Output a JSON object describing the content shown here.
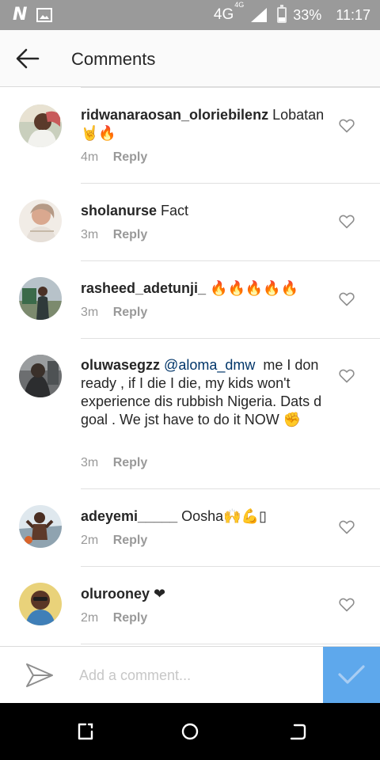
{
  "status_bar": {
    "network": "4G",
    "network_small": "4G",
    "battery_percent": "33%",
    "battery_level": 0.33,
    "time": "11:17",
    "icons": [
      "n-logo-icon",
      "image-icon",
      "signal-icon",
      "battery-icon"
    ]
  },
  "header": {
    "title": "Comments",
    "back_icon": "back-arrow-icon"
  },
  "comments": [
    {
      "username": "ridwanaraosan_oloriebilenz",
      "text": "Lobatan",
      "emoji": "🤘🔥",
      "time": "4m",
      "reply_label": "Reply"
    },
    {
      "username": "sholanurse",
      "text": "Fact",
      "emoji": "",
      "time": "3m",
      "reply_label": "Reply"
    },
    {
      "username": "rasheed_adetunji_",
      "text": "",
      "emoji": "🔥🔥🔥🔥🔥",
      "time": "3m",
      "reply_label": "Reply"
    },
    {
      "username": "oluwasegzz",
      "mention": "@aloma_dmw",
      "text": "me I don ready , if I die I die, my kids won't experience dis rubbish Nigeria. Dats d goal . We jst have to do it NOW",
      "emoji": "✊",
      "time": "3m",
      "reply_label": "Reply"
    },
    {
      "username": "adeyemi_____",
      "text": "Oosha",
      "emoji": "🙌💪▯",
      "time": "2m",
      "reply_label": "Reply"
    },
    {
      "username": "olurooney",
      "text": "",
      "emoji": "❤",
      "time": "2m",
      "reply_label": "Reply"
    }
  ],
  "input": {
    "placeholder": "Add a comment...",
    "send_icon": "paper-plane-icon",
    "post_icon": "checkmark-icon"
  },
  "colors": {
    "status_bar": "#9a9a9a",
    "header_bg": "#fafafa",
    "text": "#262626",
    "meta": "#999999",
    "mention": "#003569",
    "post_button": "#5ea8ec",
    "nav_bar": "#000000"
  },
  "nav": {
    "icons": [
      "recent-apps-icon",
      "home-icon",
      "back-icon"
    ]
  }
}
